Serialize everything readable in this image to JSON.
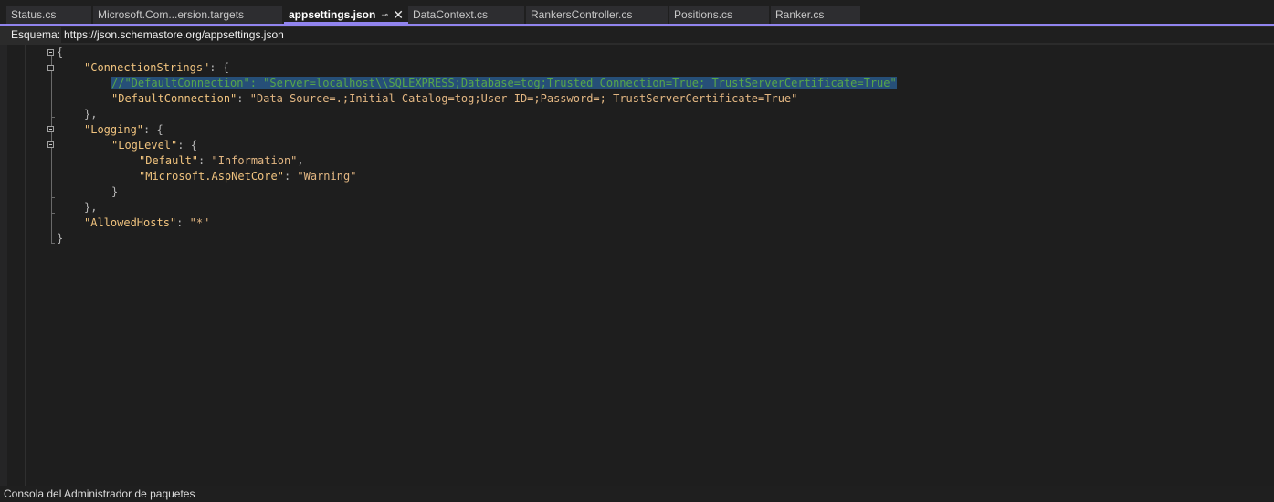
{
  "tabs": [
    {
      "label": "Status.cs"
    },
    {
      "label": "Microsoft.Com...ersion.targets"
    },
    {
      "label": "appsettings.json",
      "active": true
    },
    {
      "label": "DataContext.cs"
    },
    {
      "label": "RankersController.cs"
    },
    {
      "label": "Positions.cs"
    },
    {
      "label": "Ranker.cs"
    }
  ],
  "tab_icons": {
    "pin": "pin-icon",
    "close": "close-icon"
  },
  "schema": {
    "label": "Esquema:",
    "url": "https://json.schemastore.org/appsettings.json"
  },
  "code": {
    "l1": "{",
    "l2_key": "\"ConnectionStrings\"",
    "l2_rest": ": {",
    "l3_comment": "//\"DefaultConnection\": \"Server=localhost\\\\SQLEXPRESS;Database=tog;Trusted_Connection=True; TrustServerCertificate=True\"",
    "l4_key": "\"DefaultConnection\"",
    "l4_sep": ": ",
    "l4_val": "\"Data Source=.;Initial Catalog=tog;User ID=;Password=; TrustServerCertificate=True\"",
    "l5": "},",
    "l6_key": "\"Logging\"",
    "l6_rest": ": {",
    "l7_key": "\"LogLevel\"",
    "l7_rest": ": {",
    "l8_key": "\"Default\"",
    "l8_sep": ": ",
    "l8_val": "\"Information\"",
    "l8_end": ",",
    "l9_key": "\"Microsoft.AspNetCore\"",
    "l9_sep": ": ",
    "l9_val": "\"Warning\"",
    "l10": "}",
    "l11": "},",
    "l12_key": "\"AllowedHosts\"",
    "l12_sep": ": ",
    "l12_val": "\"*\"",
    "l13": "}"
  },
  "status": {
    "text": "Consola del Administrador de paquetes"
  },
  "colors": {
    "accent": "#9184ee",
    "key": "#f0c37e",
    "string": "#e2b682",
    "comment": "#57a64a",
    "selection": "#264f78"
  }
}
